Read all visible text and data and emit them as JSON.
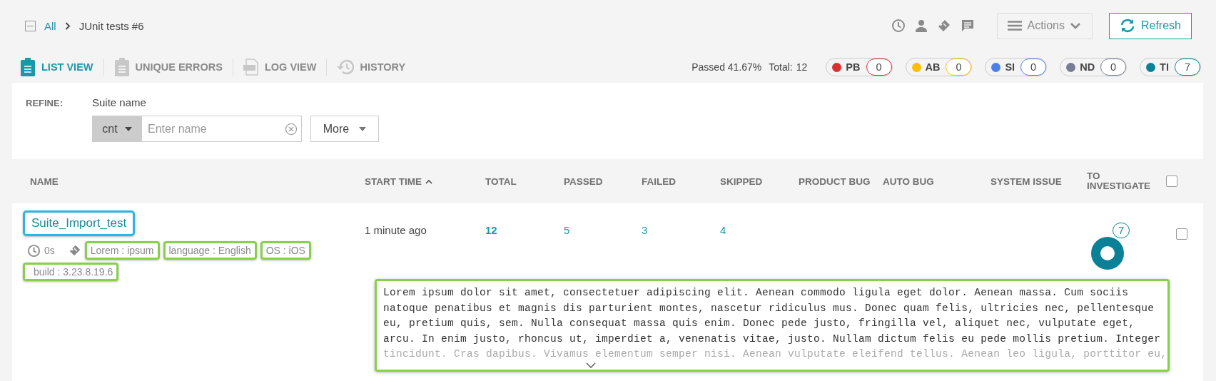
{
  "breadcrumb": {
    "root": "All",
    "current": "JUnit tests #6"
  },
  "toolbar": {
    "actions": "Actions",
    "refresh": "Refresh"
  },
  "view_tabs": [
    {
      "label": "LIST VIEW",
      "kind": "list",
      "selected": true
    },
    {
      "label": "UNIQUE ERRORS",
      "kind": "errors",
      "selected": false
    },
    {
      "label": "LOG VIEW",
      "kind": "log",
      "selected": false
    },
    {
      "label": "HISTORY",
      "kind": "history",
      "selected": false
    }
  ],
  "summary": {
    "passed": "Passed 41.67%",
    "total_label": "Total:",
    "total": "12"
  },
  "defect_badges": [
    {
      "label": "PB",
      "count": "0",
      "color": "#d9302f"
    },
    {
      "label": "AB",
      "count": "0",
      "color": "#fbbf0a"
    },
    {
      "label": "SI",
      "count": "0",
      "color": "#4a80e8"
    },
    {
      "label": "ND",
      "count": "0",
      "color": "#777f96"
    },
    {
      "label": "TI",
      "count": "7",
      "color": "#0a8197"
    }
  ],
  "refine": {
    "label": "REFINE:",
    "field_label": "Suite name",
    "condition": "cnt",
    "placeholder": "Enter name",
    "more": "More"
  },
  "table": {
    "columns": [
      {
        "label": "NAME",
        "sorted": false
      },
      {
        "label": "START TIME",
        "sorted": true
      },
      {
        "label": "TOTAL",
        "sorted": false
      },
      {
        "label": "PASSED",
        "sorted": false
      },
      {
        "label": "FAILED",
        "sorted": false
      },
      {
        "label": "SKIPPED",
        "sorted": false
      },
      {
        "label": "PRODUCT BUG",
        "sorted": false
      },
      {
        "label": "AUTO BUG",
        "sorted": false
      },
      {
        "label": "SYSTEM ISSUE",
        "sorted": false
      },
      {
        "label": "TO INVESTIGATE",
        "sorted": false
      }
    ],
    "select_all_checked": false,
    "rows": [
      {
        "name": "Suite_Import_test",
        "duration": "0s",
        "attributes": [
          "Lorem : ipsum",
          "language : English",
          "OS : iOS",
          "build : 3.23.8.19.6"
        ],
        "start_time": "1 minute ago",
        "total": "12",
        "passed": "5",
        "failed": "3",
        "skipped": "4",
        "to_investigate": "7",
        "checked": false,
        "description": [
          "Lorem ipsum dolor sit amet, consectetuer adipiscing elit. Aenean commodo ligula eget dolor. Aenean massa. Cum sociis",
          "natoque penatibus et magnis dis parturient montes, nascetur ridiculus mus. Donec quam felis, ultricies nec, pellentesque",
          "eu, pretium quis, sem. Nulla consequat massa quis enim. Donec pede justo, fringilla vel, aliquet nec, vulputate eget,",
          "arcu. In enim justo, rhoncus ut, imperdiet a, venenatis vitae, justo. Nullam dictum felis eu pede mollis pretium. Integer",
          "tincidunt. Cras dapibus. Vivamus elementum semper nisi. Aenean vulputate eleifend tellus. Aenean leo ligula, porttitor eu,"
        ]
      }
    ]
  }
}
